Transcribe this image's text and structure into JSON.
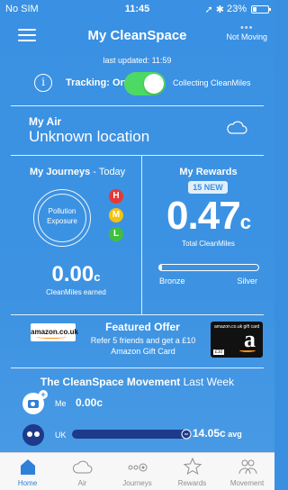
{
  "status_bar": {
    "carrier": "No SIM",
    "time": "11:45",
    "battery": "23%",
    "battery_level": 0.23
  },
  "header": {
    "title": "My CleanSpace",
    "moving_status": "Not Moving",
    "last_updated": "last updated: 11:59"
  },
  "tracking": {
    "label": "Tracking: On",
    "enabled": true,
    "right_text": "Collecting CleanMiles"
  },
  "air": {
    "title": "My Air",
    "location": "Unknown location"
  },
  "journeys": {
    "title": "My Journeys",
    "period": " - Today",
    "exposure_label_line1": "Pollution",
    "exposure_label_line2": "Exposure",
    "levels": [
      "H",
      "M",
      "L"
    ],
    "earned_value": "0.00",
    "earned_unit": "c",
    "earned_label": "CleanMiles earned"
  },
  "rewards": {
    "title": "My Rewards",
    "badge": "15 NEW",
    "value": "0.47",
    "unit": "c",
    "label": "Total CleanMiles",
    "tier_from": "Bronze",
    "tier_to": "Silver",
    "progress": 0.03
  },
  "offer": {
    "logo_text": "amazon.co.uk",
    "title": "Featured Offer",
    "text": "Refer 5 friends and get a £10 Amazon Gift Card",
    "card_logo": "amazon.co.uk gift card",
    "card_value": "£10"
  },
  "movement": {
    "title": "The CleanSpace Movement",
    "period": " Last Week",
    "me_label": "Me",
    "me_value": "0.00c",
    "uk_label": "UK",
    "uk_value": "14.05c",
    "uk_suffix": " avg"
  },
  "tabs": [
    {
      "label": "Home",
      "icon": "home-icon",
      "active": true
    },
    {
      "label": "Air",
      "icon": "cloud-icon",
      "active": false
    },
    {
      "label": "Journeys",
      "icon": "journeys-icon",
      "active": false
    },
    {
      "label": "Rewards",
      "icon": "star-icon",
      "active": false
    },
    {
      "label": "Movement",
      "icon": "people-icon",
      "active": false
    }
  ],
  "colors": {
    "background": "#3a8fe0",
    "toggle_on": "#4cd964",
    "high": "#e53935",
    "medium": "#f4c20d",
    "low": "#3fbf3f",
    "tab_active": "#2f80d9"
  }
}
